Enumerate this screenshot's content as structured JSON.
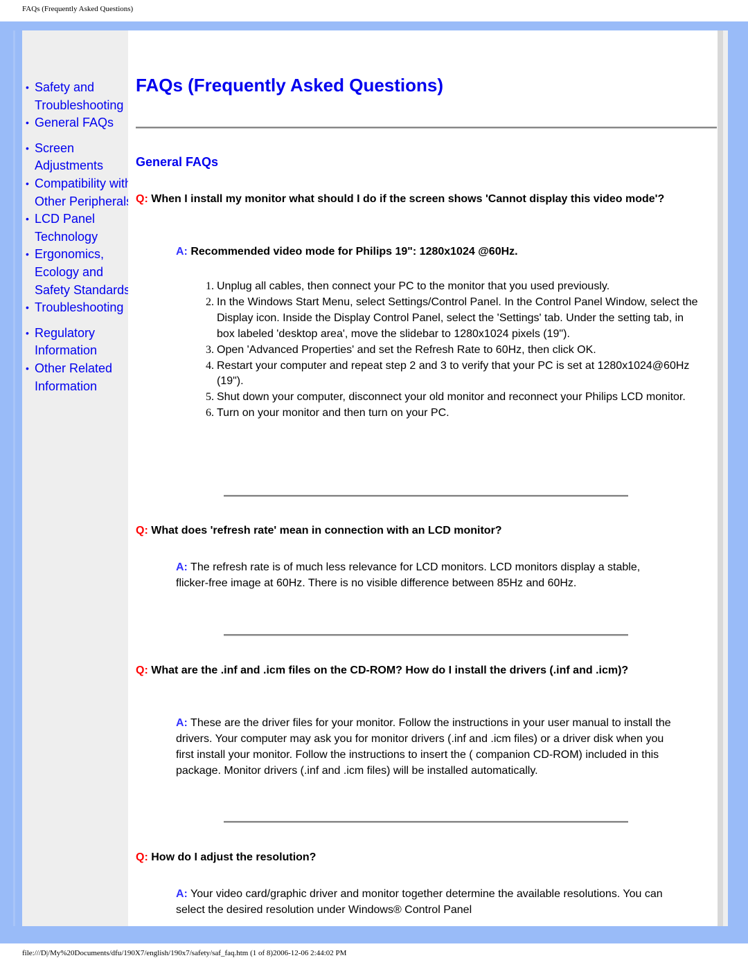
{
  "print_header": "FAQs (Frequently Asked Questions)",
  "print_footer": "file:///D|/My%20Documents/dfu/190X7/english/190x7/safety/saf_faq.htm (1 of 8)2006-12-06 2:44:02 PM",
  "colors": {
    "frame": "#99bbf8",
    "sidebar_bg": "#eeeeee",
    "link": "#0000ee",
    "question_marker": "#ff0000",
    "answer_marker": "#3333ff"
  },
  "sidebar": {
    "bullet": "•",
    "items": [
      {
        "label": "Safety and Troubleshooting"
      },
      {
        "label": "General FAQs"
      },
      {
        "label": "Screen Adjustments"
      },
      {
        "label": "Compatibility with Other Peripherals"
      },
      {
        "label": "LCD Panel Technology"
      },
      {
        "label": "Ergonomics, Ecology and Safety Standards"
      },
      {
        "label": "Troubleshooting"
      },
      {
        "label": "Regulatory Information"
      },
      {
        "label": "Other Related Information"
      }
    ]
  },
  "main": {
    "title": "FAQs (Frequently Asked Questions)",
    "section_title": "General FAQs",
    "q_marker": "Q:",
    "a_marker": "A:",
    "faqs": [
      {
        "question": "When I install my monitor what should I do if the screen shows 'Cannot display this video mode'?",
        "answer": "Recommended video mode for Philips 19\": 1280x1024 @60Hz.",
        "steps": [
          "Unplug all cables, then connect your PC to the monitor that you used previously.",
          "In the Windows Start Menu, select Settings/Control Panel. In the Control Panel Window, select the Display icon. Inside the Display Control Panel, select the 'Settings' tab. Under the setting tab, in box labeled 'desktop area', move the slidebar to 1280x1024 pixels (19\").",
          "Open 'Advanced Properties' and set the Refresh Rate to 60Hz, then click OK.",
          "Restart your computer and repeat step 2 and 3 to verify that your PC is set at 1280x1024@60Hz (19\").",
          "Shut down your computer, disconnect your old monitor and reconnect your Philips LCD monitor.",
          "Turn on your monitor and then turn on your PC."
        ]
      },
      {
        "question": "What does 'refresh rate' mean in connection with an LCD monitor?",
        "answer": "The refresh rate is of much less relevance for LCD monitors. LCD monitors display a stable, flicker-free image at 60Hz. There is no visible difference between 85Hz and 60Hz."
      },
      {
        "question": "What are the .inf and .icm files on the CD-ROM? How do I install the drivers (.inf and .icm)?",
        "answer": "These are the driver files for your monitor. Follow the instructions in your user manual to install the drivers. Your computer may ask you for monitor drivers (.inf and .icm files) or a driver disk when you first install your monitor. Follow the instructions to insert the ( companion CD-ROM) included in this package. Monitor drivers (.inf and .icm files) will be installed automatically."
      },
      {
        "question": "How do I adjust the resolution?",
        "answer": "Your video card/graphic driver and monitor together determine the available resolutions. You can select the desired resolution under Windows® Control Panel"
      }
    ]
  }
}
